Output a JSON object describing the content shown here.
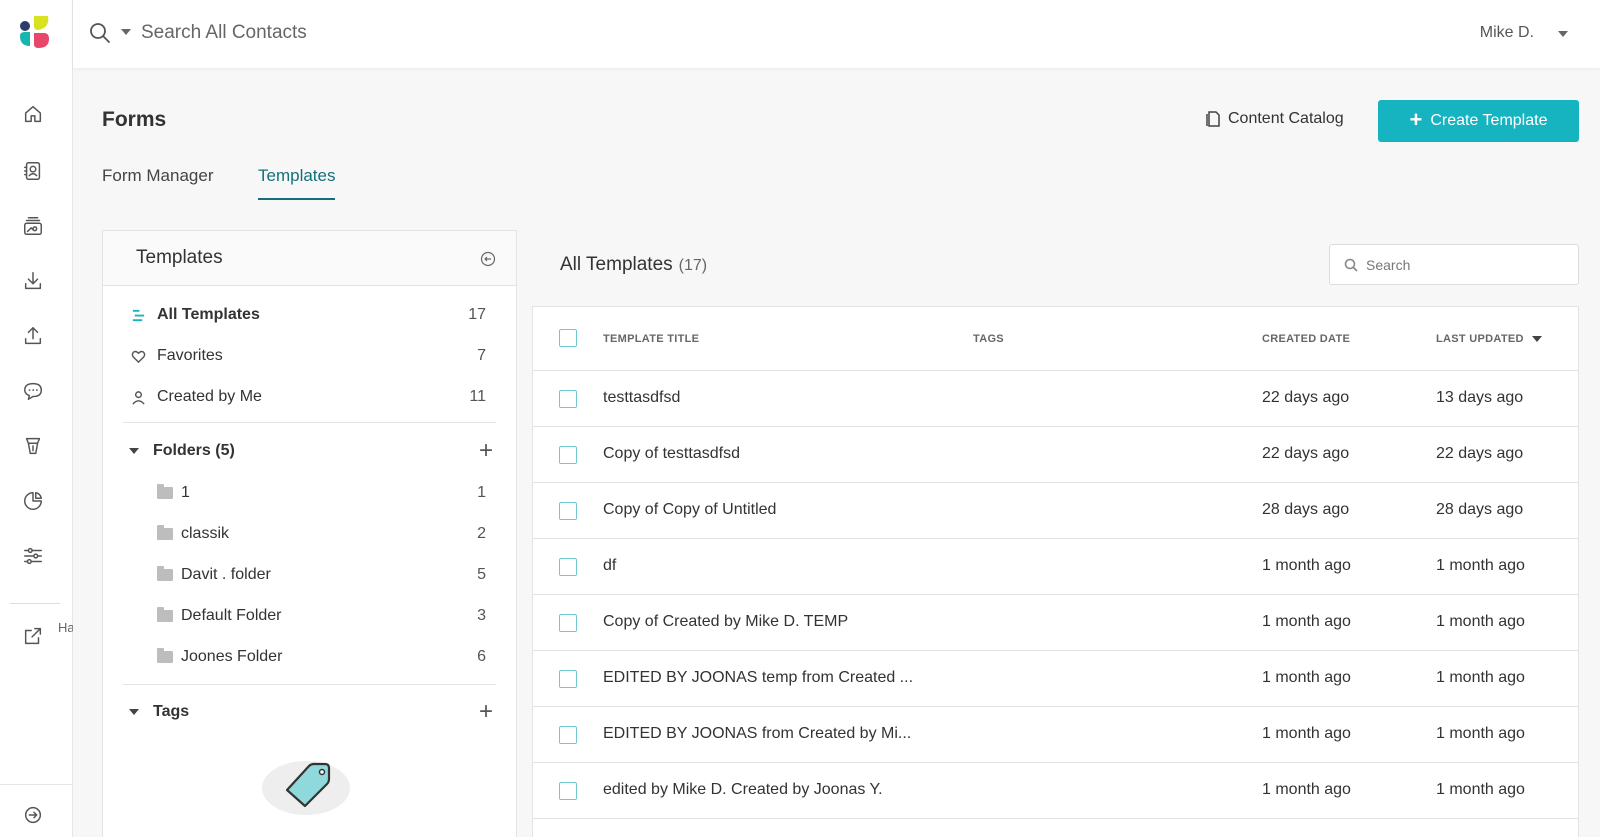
{
  "topbar": {
    "search_placeholder": "Search All Contacts",
    "user_name": "Mike D."
  },
  "rail": {
    "help_label": "Ha Da",
    "icons": [
      "home-icon",
      "contacts-icon",
      "campaigns-icon",
      "download-icon",
      "upload-icon",
      "chat-icon",
      "content-icon",
      "reports-icon",
      "settings-icon",
      "external-link-icon",
      "expand-icon"
    ]
  },
  "page": {
    "title": "Forms",
    "content_catalog": "Content Catalog",
    "create_template": "Create Template",
    "tabs": [
      {
        "label": "Form Manager",
        "active": false
      },
      {
        "label": "Templates",
        "active": true
      }
    ]
  },
  "panel": {
    "title": "Templates",
    "nav": [
      {
        "label": "All Templates",
        "count": "17",
        "icon": "list-icon",
        "active": true
      },
      {
        "label": "Favorites",
        "count": "7",
        "icon": "heart-icon"
      },
      {
        "label": "Created by Me",
        "count": "11",
        "icon": "user-icon"
      }
    ],
    "folders_label": "Folders (5)",
    "folders": [
      {
        "label": "1",
        "count": "1"
      },
      {
        "label": "classik",
        "count": "2"
      },
      {
        "label": "Davit . folder",
        "count": "5"
      },
      {
        "label": "Default Folder",
        "count": "3"
      },
      {
        "label": "Joones Folder",
        "count": "6"
      }
    ],
    "tags_label": "Tags"
  },
  "list": {
    "title": "All Templates",
    "count": "(17)",
    "search_placeholder": "Search",
    "columns": {
      "title": "TEMPLATE TITLE",
      "tags": "TAGS",
      "created": "CREATED DATE",
      "updated": "LAST UPDATED"
    },
    "rows": [
      {
        "title": "testtasdfsd",
        "tags": "",
        "created": "22 days ago",
        "updated": "13 days ago"
      },
      {
        "title": "Copy of testtasdfsd",
        "tags": "",
        "created": "22 days ago",
        "updated": "22 days ago"
      },
      {
        "title": "Copy of Copy of Untitled",
        "tags": "",
        "created": "28 days ago",
        "updated": "28 days ago"
      },
      {
        "title": "df",
        "tags": "",
        "created": "1 month ago",
        "updated": "1 month ago"
      },
      {
        "title": "Copy of Created by Mike D. TEMP",
        "tags": "",
        "created": "1 month ago",
        "updated": "1 month ago"
      },
      {
        "title": "EDITED BY JOONAS temp from Created ...",
        "tags": "",
        "created": "1 month ago",
        "updated": "1 month ago"
      },
      {
        "title": "EDITED BY JOONAS from Created by Mi...",
        "tags": "",
        "created": "1 month ago",
        "updated": "1 month ago"
      },
      {
        "title": "edited by Mike D. Created by Joonas Y.",
        "tags": "",
        "created": "1 month ago",
        "updated": "1 month ago"
      }
    ]
  },
  "colors": {
    "accent": "#16b3c0",
    "tab_active": "#13707a",
    "checkbox": "#6fc8d2"
  }
}
